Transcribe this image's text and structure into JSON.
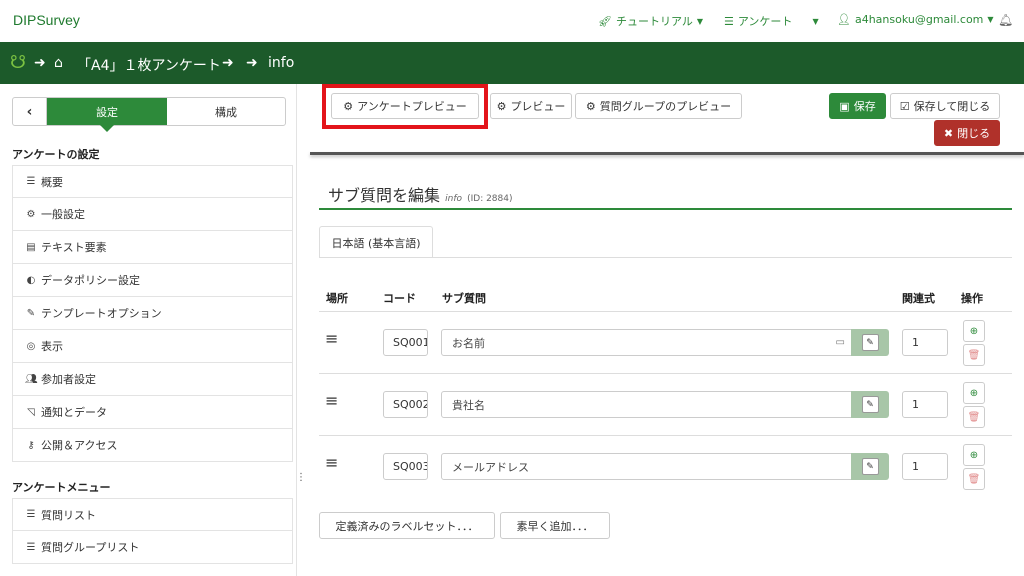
{
  "nav": {
    "brand": "DIPSurvey",
    "tutorial": "チュートリアル",
    "survey": "アンケート",
    "user": "a4hansoku@gmail.com"
  },
  "breadcrumb": {
    "survey_name": "「A4」１枚アンケート",
    "current": "info"
  },
  "sidebar": {
    "tab_settings": "設定",
    "tab_structure": "構成",
    "section1": "アンケートの設定",
    "items1": [
      {
        "label": "概要",
        "icon": "list-icon"
      },
      {
        "label": "一般設定",
        "icon": "gears-icon"
      },
      {
        "label": "テキスト要素",
        "icon": "file-text-icon"
      },
      {
        "label": "データポリシー設定",
        "icon": "shield-icon"
      },
      {
        "label": "テンプレートオプション",
        "icon": "brush-icon"
      },
      {
        "label": "表示",
        "icon": "eye-slash-icon"
      },
      {
        "label": "参加者設定",
        "icon": "users-icon"
      },
      {
        "label": "通知とデータ",
        "icon": "rss-icon"
      },
      {
        "label": "公開＆アクセス",
        "icon": "key-icon"
      }
    ],
    "section2": "アンケートメニュー",
    "items2": [
      {
        "label": "質問リスト",
        "icon": "list-icon"
      },
      {
        "label": "質問グループリスト",
        "icon": "list-icon"
      }
    ]
  },
  "toolbar": {
    "survey_preview": "アンケートプレビュー",
    "preview": "プレビュー",
    "group_preview": "質問グループのプレビュー",
    "save": "保存",
    "save_close": "保存して閉じる",
    "close": "閉じる"
  },
  "editor": {
    "title": "サブ質問を編集",
    "question_code": "info",
    "question_id": "(ID: 2884)",
    "language_tab": "日本語 (基本言語)",
    "headers": {
      "position": "場所",
      "code": "コード",
      "subquestion": "サブ質問",
      "relevance": "関連式",
      "actions": "操作"
    },
    "rows": [
      {
        "code": "SQ001",
        "text": "お名前",
        "relevance": "1"
      },
      {
        "code": "SQ002",
        "text": "貴社名",
        "relevance": "1"
      },
      {
        "code": "SQ003",
        "text": "メールアドレス",
        "relevance": "1"
      }
    ],
    "label_sets": "定義済みのラベルセット．．．",
    "quick_add": "素早く追加．．．"
  }
}
